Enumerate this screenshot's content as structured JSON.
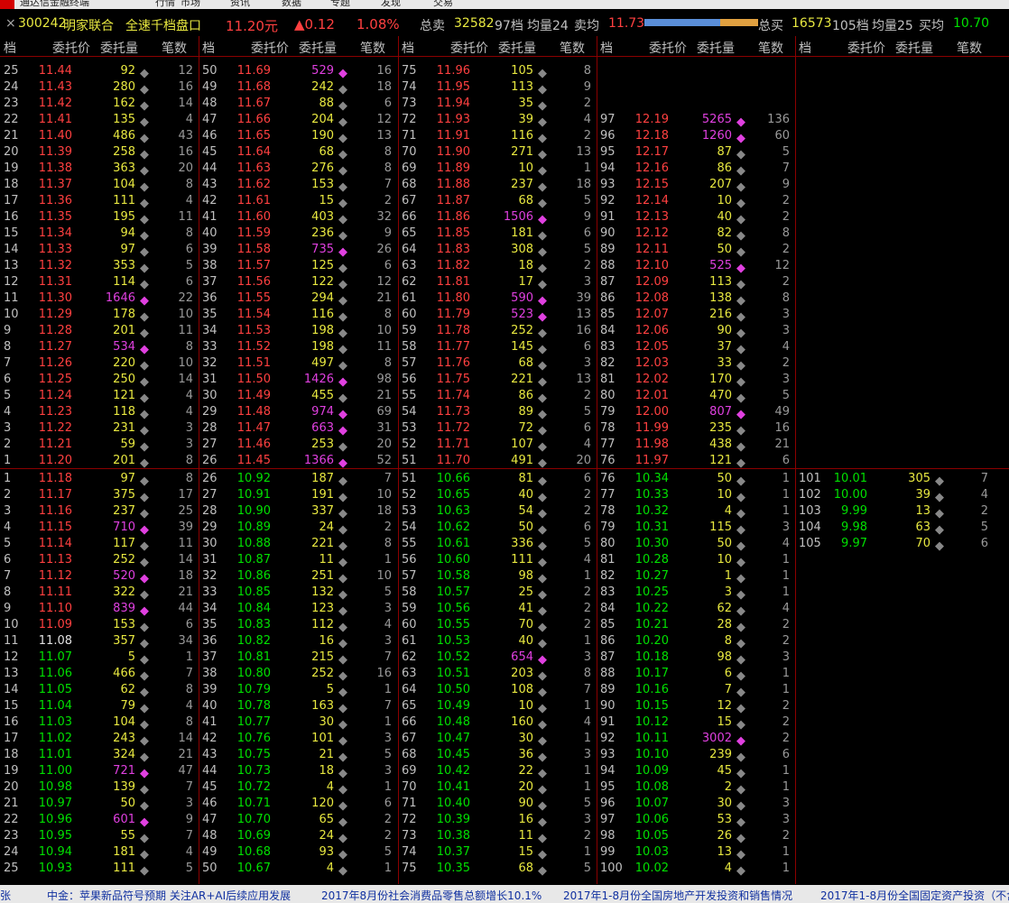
{
  "window": {
    "app_title": "通达信金融终端",
    "menu": [
      "行情",
      "市场",
      "资讯",
      "数据",
      "专题",
      "发现",
      "交易"
    ]
  },
  "stock": {
    "close_glyph": "×",
    "code": "300242",
    "name": "明家联合",
    "view_title": "全速千档盘口",
    "price": "11.20元",
    "change": "▲0.12",
    "change_pct": "1.08%",
    "sell_total_label": "总卖",
    "sell_total": "32582",
    "sell_levels": "97档",
    "sell_avg_label": "均量24",
    "sell_avgprice_label": "卖均",
    "sell_avgprice": "11.73",
    "buy_total_label": "总买",
    "buy_total": "16573",
    "buy_levels": "105档",
    "buy_avg_label": "均量25",
    "buy_avgprice_label": "买均",
    "buy_avgprice": "10.70",
    "sell_ratio": 0.663,
    "colors": {
      "up": "#ff4040",
      "down": "#00e000",
      "volume": "#e8e840",
      "big": "#e040e0",
      "sell_bar": "#5a8ed8",
      "buy_bar": "#e0a040"
    }
  },
  "headers": {
    "level": "档",
    "price": "委托价",
    "volume": "委托量",
    "count": "笔数"
  },
  "sell": {
    "col1": [
      [
        "25",
        "11.44",
        "92",
        "12"
      ],
      [
        "24",
        "11.43",
        "280",
        "16"
      ],
      [
        "23",
        "11.42",
        "162",
        "14"
      ],
      [
        "22",
        "11.41",
        "135",
        "4"
      ],
      [
        "21",
        "11.40",
        "486",
        "43"
      ],
      [
        "20",
        "11.39",
        "258",
        "16"
      ],
      [
        "19",
        "11.38",
        "363",
        "20"
      ],
      [
        "18",
        "11.37",
        "104",
        "8"
      ],
      [
        "17",
        "11.36",
        "111",
        "4"
      ],
      [
        "16",
        "11.35",
        "195",
        "11"
      ],
      [
        "15",
        "11.34",
        "94",
        "8"
      ],
      [
        "14",
        "11.33",
        "97",
        "6"
      ],
      [
        "13",
        "11.32",
        "353",
        "5"
      ],
      [
        "12",
        "11.31",
        "114",
        "6"
      ],
      [
        "11",
        "11.30",
        "1646",
        "22"
      ],
      [
        "10",
        "11.29",
        "178",
        "10"
      ],
      [
        "9",
        "11.28",
        "201",
        "11"
      ],
      [
        "8",
        "11.27",
        "534",
        "8"
      ],
      [
        "7",
        "11.26",
        "220",
        "10"
      ],
      [
        "6",
        "11.25",
        "250",
        "14"
      ],
      [
        "5",
        "11.24",
        "121",
        "4"
      ],
      [
        "4",
        "11.23",
        "118",
        "4"
      ],
      [
        "3",
        "11.22",
        "231",
        "3"
      ],
      [
        "2",
        "11.21",
        "59",
        "3"
      ],
      [
        "1",
        "11.20",
        "201",
        "8"
      ]
    ],
    "col2": [
      [
        "50",
        "11.69",
        "529",
        "16"
      ],
      [
        "49",
        "11.68",
        "242",
        "18"
      ],
      [
        "48",
        "11.67",
        "88",
        "6"
      ],
      [
        "47",
        "11.66",
        "204",
        "12"
      ],
      [
        "46",
        "11.65",
        "190",
        "13"
      ],
      [
        "45",
        "11.64",
        "68",
        "8"
      ],
      [
        "44",
        "11.63",
        "276",
        "8"
      ],
      [
        "43",
        "11.62",
        "153",
        "7"
      ],
      [
        "42",
        "11.61",
        "15",
        "2"
      ],
      [
        "41",
        "11.60",
        "403",
        "32"
      ],
      [
        "40",
        "11.59",
        "236",
        "9"
      ],
      [
        "39",
        "11.58",
        "735",
        "26"
      ],
      [
        "38",
        "11.57",
        "125",
        "6"
      ],
      [
        "37",
        "11.56",
        "122",
        "12"
      ],
      [
        "36",
        "11.55",
        "294",
        "21"
      ],
      [
        "35",
        "11.54",
        "116",
        "8"
      ],
      [
        "34",
        "11.53",
        "198",
        "10"
      ],
      [
        "33",
        "11.52",
        "198",
        "11"
      ],
      [
        "32",
        "11.51",
        "497",
        "8"
      ],
      [
        "31",
        "11.50",
        "1426",
        "98"
      ],
      [
        "30",
        "11.49",
        "455",
        "21"
      ],
      [
        "29",
        "11.48",
        "974",
        "69"
      ],
      [
        "28",
        "11.47",
        "663",
        "31"
      ],
      [
        "27",
        "11.46",
        "253",
        "20"
      ],
      [
        "26",
        "11.45",
        "1366",
        "52"
      ]
    ],
    "col3": [
      [
        "75",
        "11.96",
        "105",
        "8"
      ],
      [
        "74",
        "11.95",
        "113",
        "9"
      ],
      [
        "73",
        "11.94",
        "35",
        "2"
      ],
      [
        "72",
        "11.93",
        "39",
        "4"
      ],
      [
        "71",
        "11.91",
        "116",
        "2"
      ],
      [
        "70",
        "11.90",
        "271",
        "13"
      ],
      [
        "69",
        "11.89",
        "10",
        "1"
      ],
      [
        "68",
        "11.88",
        "237",
        "18"
      ],
      [
        "67",
        "11.87",
        "68",
        "5"
      ],
      [
        "66",
        "11.86",
        "1506",
        "9"
      ],
      [
        "65",
        "11.85",
        "181",
        "6"
      ],
      [
        "64",
        "11.83",
        "308",
        "5"
      ],
      [
        "63",
        "11.82",
        "18",
        "2"
      ],
      [
        "62",
        "11.81",
        "17",
        "3"
      ],
      [
        "61",
        "11.80",
        "590",
        "39"
      ],
      [
        "60",
        "11.79",
        "523",
        "13"
      ],
      [
        "59",
        "11.78",
        "252",
        "16"
      ],
      [
        "58",
        "11.77",
        "145",
        "6"
      ],
      [
        "57",
        "11.76",
        "68",
        "3"
      ],
      [
        "56",
        "11.75",
        "221",
        "13"
      ],
      [
        "55",
        "11.74",
        "86",
        "2"
      ],
      [
        "54",
        "11.73",
        "89",
        "5"
      ],
      [
        "53",
        "11.72",
        "72",
        "6"
      ],
      [
        "52",
        "11.71",
        "107",
        "4"
      ],
      [
        "51",
        "11.70",
        "491",
        "20"
      ]
    ],
    "col4": [
      [
        "97",
        "12.19",
        "5265",
        "136"
      ],
      [
        "96",
        "12.18",
        "1260",
        "60"
      ],
      [
        "95",
        "12.17",
        "87",
        "5"
      ],
      [
        "94",
        "12.16",
        "86",
        "7"
      ],
      [
        "93",
        "12.15",
        "207",
        "9"
      ],
      [
        "92",
        "12.14",
        "10",
        "2"
      ],
      [
        "91",
        "12.13",
        "40",
        "2"
      ],
      [
        "90",
        "12.12",
        "82",
        "8"
      ],
      [
        "89",
        "12.11",
        "50",
        "2"
      ],
      [
        "88",
        "12.10",
        "525",
        "12"
      ],
      [
        "87",
        "12.09",
        "113",
        "2"
      ],
      [
        "86",
        "12.08",
        "138",
        "8"
      ],
      [
        "85",
        "12.07",
        "216",
        "3"
      ],
      [
        "84",
        "12.06",
        "90",
        "3"
      ],
      [
        "83",
        "12.05",
        "37",
        "4"
      ],
      [
        "82",
        "12.03",
        "33",
        "2"
      ],
      [
        "81",
        "12.02",
        "170",
        "3"
      ],
      [
        "80",
        "12.01",
        "470",
        "5"
      ],
      [
        "79",
        "12.00",
        "807",
        "49"
      ],
      [
        "78",
        "11.99",
        "235",
        "16"
      ],
      [
        "77",
        "11.98",
        "438",
        "21"
      ],
      [
        "76",
        "11.97",
        "121",
        "6"
      ]
    ]
  },
  "buy": {
    "col1": [
      [
        "1",
        "11.18",
        "97",
        "8"
      ],
      [
        "2",
        "11.17",
        "375",
        "17"
      ],
      [
        "3",
        "11.16",
        "237",
        "25"
      ],
      [
        "4",
        "11.15",
        "710",
        "39"
      ],
      [
        "5",
        "11.14",
        "117",
        "11"
      ],
      [
        "6",
        "11.13",
        "252",
        "14"
      ],
      [
        "7",
        "11.12",
        "520",
        "18"
      ],
      [
        "8",
        "11.11",
        "322",
        "21"
      ],
      [
        "9",
        "11.10",
        "839",
        "44"
      ],
      [
        "10",
        "11.09",
        "153",
        "6"
      ],
      [
        "11",
        "11.08",
        "357",
        "34"
      ],
      [
        "12",
        "11.07",
        "5",
        "1"
      ],
      [
        "13",
        "11.06",
        "466",
        "7"
      ],
      [
        "14",
        "11.05",
        "62",
        "8"
      ],
      [
        "15",
        "11.04",
        "79",
        "4"
      ],
      [
        "16",
        "11.03",
        "104",
        "8"
      ],
      [
        "17",
        "11.02",
        "243",
        "14"
      ],
      [
        "18",
        "11.01",
        "324",
        "21"
      ],
      [
        "19",
        "11.00",
        "721",
        "47"
      ],
      [
        "20",
        "10.98",
        "139",
        "7"
      ],
      [
        "21",
        "10.97",
        "50",
        "3"
      ],
      [
        "22",
        "10.96",
        "601",
        "9"
      ],
      [
        "23",
        "10.95",
        "55",
        "7"
      ],
      [
        "24",
        "10.94",
        "181",
        "4"
      ],
      [
        "25",
        "10.93",
        "111",
        "5"
      ]
    ],
    "col2": [
      [
        "26",
        "10.92",
        "187",
        "7"
      ],
      [
        "27",
        "10.91",
        "191",
        "10"
      ],
      [
        "28",
        "10.90",
        "337",
        "18"
      ],
      [
        "29",
        "10.89",
        "24",
        "2"
      ],
      [
        "30",
        "10.88",
        "221",
        "8"
      ],
      [
        "31",
        "10.87",
        "11",
        "1"
      ],
      [
        "32",
        "10.86",
        "251",
        "10"
      ],
      [
        "33",
        "10.85",
        "132",
        "5"
      ],
      [
        "34",
        "10.84",
        "123",
        "3"
      ],
      [
        "35",
        "10.83",
        "112",
        "4"
      ],
      [
        "36",
        "10.82",
        "16",
        "3"
      ],
      [
        "37",
        "10.81",
        "215",
        "7"
      ],
      [
        "38",
        "10.80",
        "252",
        "16"
      ],
      [
        "39",
        "10.79",
        "5",
        "1"
      ],
      [
        "40",
        "10.78",
        "163",
        "7"
      ],
      [
        "41",
        "10.77",
        "30",
        "1"
      ],
      [
        "42",
        "10.76",
        "101",
        "3"
      ],
      [
        "43",
        "10.75",
        "21",
        "5"
      ],
      [
        "44",
        "10.73",
        "18",
        "3"
      ],
      [
        "45",
        "10.72",
        "4",
        "1"
      ],
      [
        "46",
        "10.71",
        "120",
        "6"
      ],
      [
        "47",
        "10.70",
        "65",
        "2"
      ],
      [
        "48",
        "10.69",
        "24",
        "2"
      ],
      [
        "49",
        "10.68",
        "93",
        "5"
      ],
      [
        "50",
        "10.67",
        "4",
        "1"
      ]
    ],
    "col3": [
      [
        "51",
        "10.66",
        "81",
        "6"
      ],
      [
        "52",
        "10.65",
        "40",
        "2"
      ],
      [
        "53",
        "10.63",
        "54",
        "2"
      ],
      [
        "54",
        "10.62",
        "50",
        "6"
      ],
      [
        "55",
        "10.61",
        "336",
        "5"
      ],
      [
        "56",
        "10.60",
        "111",
        "4"
      ],
      [
        "57",
        "10.58",
        "98",
        "1"
      ],
      [
        "58",
        "10.57",
        "25",
        "2"
      ],
      [
        "59",
        "10.56",
        "41",
        "2"
      ],
      [
        "60",
        "10.55",
        "70",
        "2"
      ],
      [
        "61",
        "10.53",
        "40",
        "1"
      ],
      [
        "62",
        "10.52",
        "654",
        "3"
      ],
      [
        "63",
        "10.51",
        "203",
        "8"
      ],
      [
        "64",
        "10.50",
        "108",
        "7"
      ],
      [
        "65",
        "10.49",
        "10",
        "1"
      ],
      [
        "66",
        "10.48",
        "160",
        "4"
      ],
      [
        "67",
        "10.47",
        "30",
        "1"
      ],
      [
        "68",
        "10.45",
        "36",
        "3"
      ],
      [
        "69",
        "10.42",
        "22",
        "1"
      ],
      [
        "70",
        "10.41",
        "20",
        "1"
      ],
      [
        "71",
        "10.40",
        "90",
        "5"
      ],
      [
        "72",
        "10.39",
        "16",
        "3"
      ],
      [
        "73",
        "10.38",
        "11",
        "2"
      ],
      [
        "74",
        "10.37",
        "15",
        "1"
      ],
      [
        "75",
        "10.35",
        "68",
        "5"
      ]
    ],
    "col4": [
      [
        "76",
        "10.34",
        "50",
        "1"
      ],
      [
        "77",
        "10.33",
        "10",
        "1"
      ],
      [
        "78",
        "10.32",
        "4",
        "1"
      ],
      [
        "79",
        "10.31",
        "115",
        "3"
      ],
      [
        "80",
        "10.30",
        "50",
        "4"
      ],
      [
        "81",
        "10.28",
        "10",
        "1"
      ],
      [
        "82",
        "10.27",
        "1",
        "1"
      ],
      [
        "83",
        "10.25",
        "3",
        "1"
      ],
      [
        "84",
        "10.22",
        "62",
        "4"
      ],
      [
        "85",
        "10.21",
        "28",
        "2"
      ],
      [
        "86",
        "10.20",
        "8",
        "2"
      ],
      [
        "87",
        "10.18",
        "98",
        "3"
      ],
      [
        "88",
        "10.17",
        "6",
        "1"
      ],
      [
        "89",
        "10.16",
        "7",
        "1"
      ],
      [
        "90",
        "10.15",
        "12",
        "2"
      ],
      [
        "91",
        "10.12",
        "15",
        "2"
      ],
      [
        "92",
        "10.11",
        "3002",
        "2"
      ],
      [
        "93",
        "10.10",
        "239",
        "6"
      ],
      [
        "94",
        "10.09",
        "45",
        "1"
      ],
      [
        "95",
        "10.08",
        "2",
        "1"
      ],
      [
        "96",
        "10.07",
        "30",
        "3"
      ],
      [
        "97",
        "10.06",
        "53",
        "3"
      ],
      [
        "98",
        "10.05",
        "26",
        "2"
      ],
      [
        "99",
        "10.03",
        "13",
        "1"
      ],
      [
        "100",
        "10.02",
        "4",
        "1"
      ]
    ],
    "col5": [
      [
        "101",
        "10.01",
        "305",
        "7"
      ],
      [
        "102",
        "10.00",
        "39",
        "4"
      ],
      [
        "103",
        "9.99",
        "13",
        "2"
      ],
      [
        "104",
        "9.98",
        "63",
        "5"
      ],
      [
        "105",
        "9.97",
        "70",
        "6"
      ]
    ]
  },
  "news": [
    "张",
    "中金：苹果新品符号预期 关注AR+AI后续应用发展",
    "2017年8月份社会消费品零售总额增长10.1%",
    "2017年1-8月份全国房地产开发投资和销售情况",
    "2017年1-8月份全国固定资产投资（不含"
  ]
}
